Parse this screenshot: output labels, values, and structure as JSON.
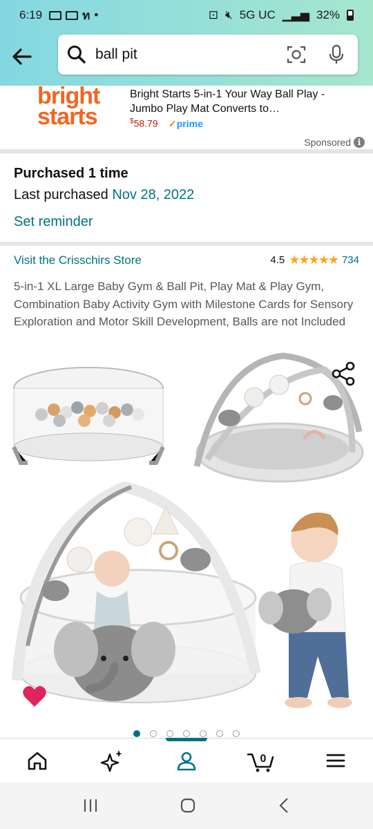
{
  "status_bar": {
    "time": "6:19",
    "network": "5G UC",
    "battery": "32%"
  },
  "search": {
    "query": "ball pit"
  },
  "ad": {
    "brand_logo_line1": "bright",
    "brand_logo_line2": "starts",
    "title": "Bright Starts 5-in-1 Your Way Ball Play - Jumbo Play Mat Converts to…",
    "price_symbol": "$",
    "price": "58.79",
    "prime_check": "✓",
    "prime_label": "prime",
    "sponsored_label": "Sponsored"
  },
  "purchase": {
    "count_label": "Purchased 1 time",
    "last_label": "Last purchased",
    "last_date": "Nov 28, 2022",
    "reminder_label": "Set reminder"
  },
  "product": {
    "store_link": "Visit the Crisschirs Store",
    "rating": "4.5",
    "stars": "★★★★★",
    "review_count": "734",
    "description": "5-in-1 XL Large Baby Gym & Ball Pit, Play Mat & Play Gym, Combination Baby Activity Gym with Milestone Cards for Sensory Exploration and Motor Skill Development, Balls are not Included"
  },
  "carousel": {
    "image_count": 7,
    "active_index": 0
  },
  "bottom_nav": {
    "cart_count": "0",
    "active": "account"
  },
  "colors": {
    "accent": "#007185",
    "header_gradient_start": "#84d8e2",
    "header_gradient_end": "#a6e6cf",
    "price": "#b12704",
    "stars": "#ffa41c",
    "heart": "#e0245e",
    "brand": "#f26522"
  }
}
